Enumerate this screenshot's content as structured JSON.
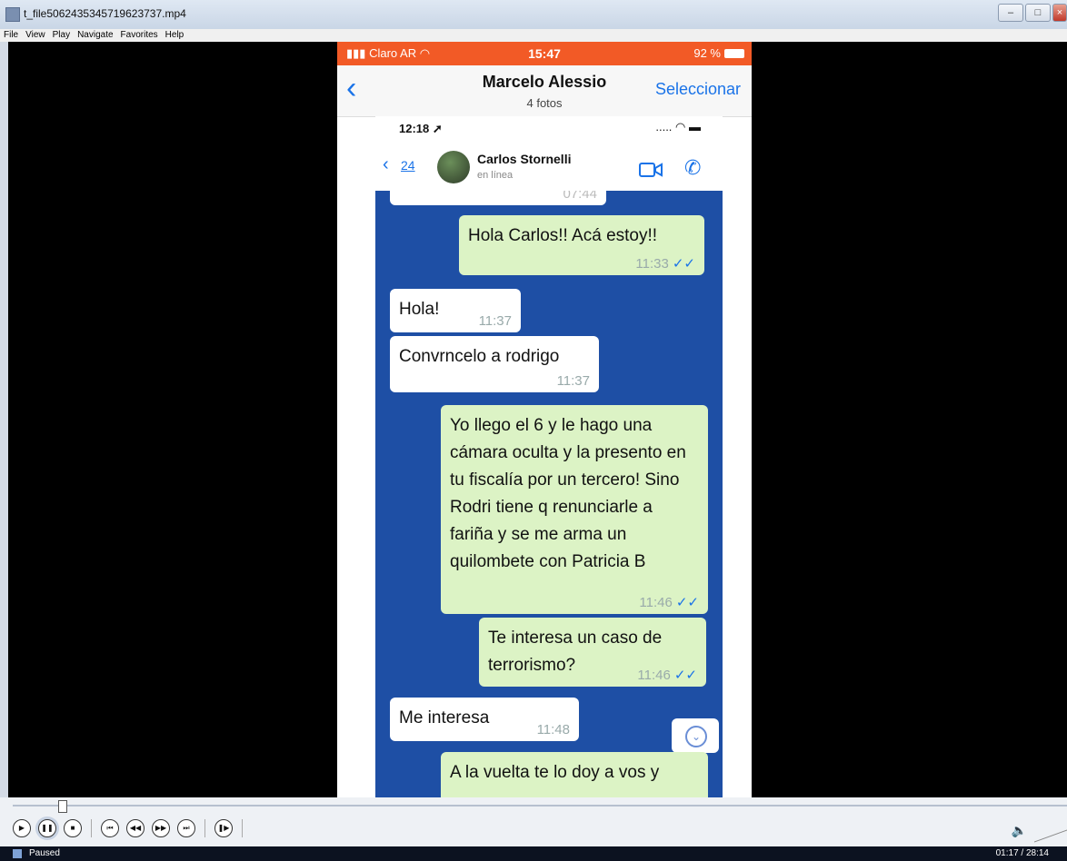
{
  "window": {
    "title": "t_file5062435345719623737.mp4"
  },
  "menu": [
    "File",
    "View",
    "Play",
    "Navigate",
    "Favorites",
    "Help"
  ],
  "phone": {
    "carrier": "Claro AR",
    "time": "15:47",
    "battery": "92 %",
    "contact_name": "Marcelo Alessio",
    "contact_sub": "4 fotos",
    "select_label": "Seleccionar"
  },
  "inner": {
    "time": "12:18",
    "back_count": "24",
    "contact": "Carlos Stornelli",
    "status": "en línea"
  },
  "messages": [
    {
      "dir": "in",
      "text": "",
      "time": "07:44"
    },
    {
      "dir": "out",
      "text": "Hola Carlos!! Acá estoy!!",
      "time": "11:33"
    },
    {
      "dir": "in",
      "text": "Hola!",
      "time": "11:37"
    },
    {
      "dir": "in",
      "text": "Convrncelo a rodrigo",
      "time": "11:37"
    },
    {
      "dir": "out",
      "text": "Yo llego el 6 y le hago una cámara oculta y la presento en tu fiscalía por un tercero! Sino Rodri tiene q renunciarle a fariña y se me arma un quilombete con Patricia B",
      "time": "11:46"
    },
    {
      "dir": "out",
      "text": "Te interesa un caso de terrorismo?",
      "time": "11:46"
    },
    {
      "dir": "in",
      "text": "Me interesa",
      "time": "11:48"
    },
    {
      "dir": "out",
      "text": "A la vuelta te lo doy a vos y",
      "time": ""
    }
  ],
  "player": {
    "status": "Paused",
    "time": "01:17 / 28:14"
  },
  "colors": {
    "ios_status": "#f25a26",
    "chat_bg": "#1e4fa5",
    "bubble_out": "#dcf3c5",
    "link": "#1a73e8"
  }
}
